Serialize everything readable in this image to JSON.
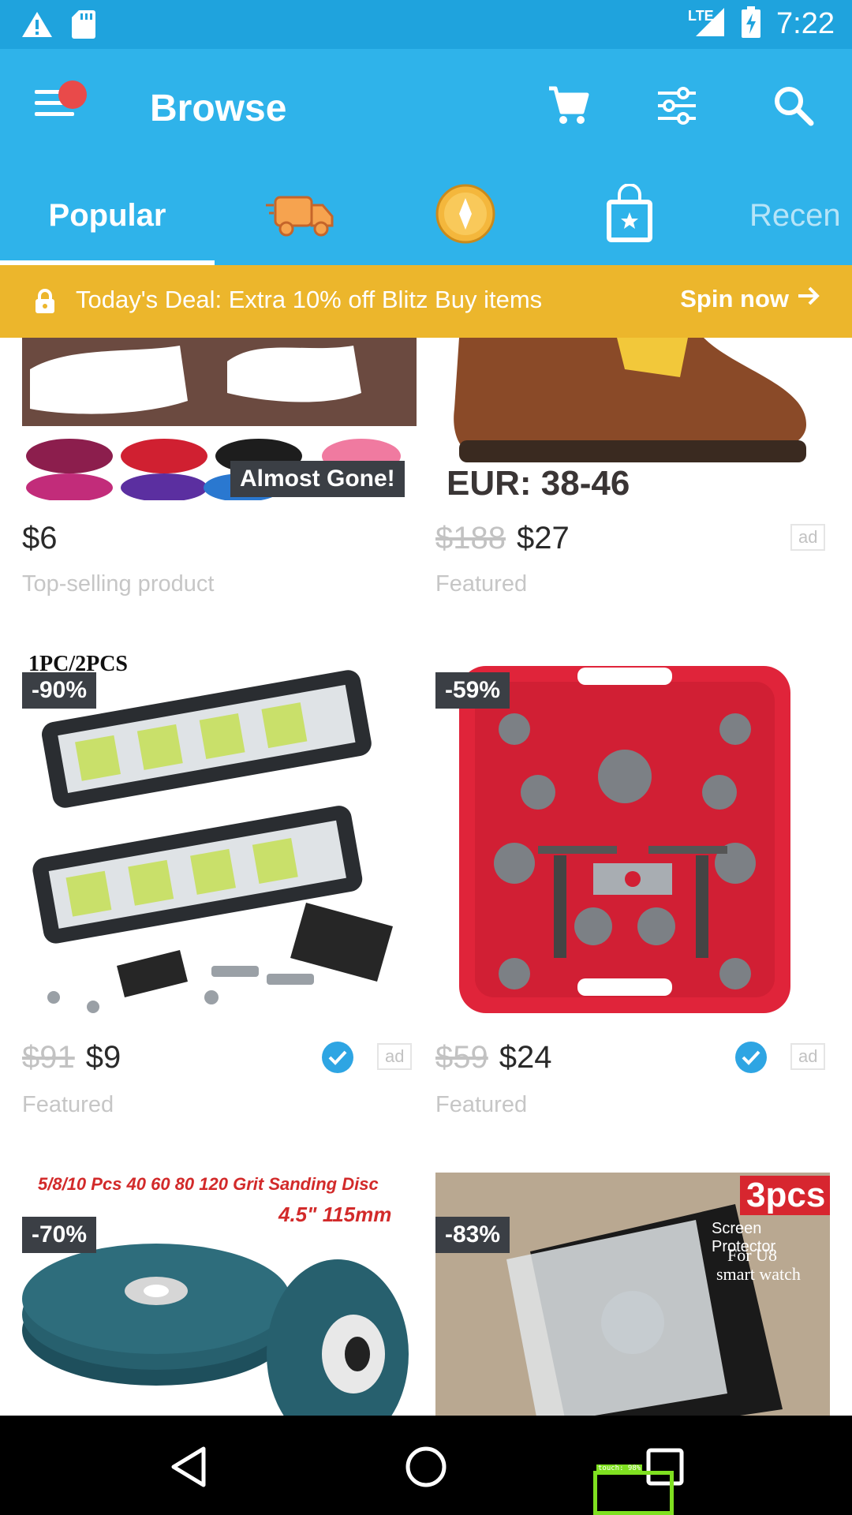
{
  "status_bar": {
    "time": "7:22",
    "network": "LTE",
    "icons": [
      "warning-icon",
      "sd-card-icon",
      "signal-icon",
      "battery-charging-icon"
    ]
  },
  "app_bar": {
    "title": "Browse",
    "notification_dot_color": "#e94a4a",
    "actions": [
      "cart-icon",
      "filter-icon",
      "search-icon"
    ]
  },
  "tabs": {
    "active": "Popular",
    "items": [
      {
        "label": "Popular",
        "icon": ""
      },
      {
        "label": "",
        "icon": "fast-shipping-truck-icon"
      },
      {
        "label": "",
        "icon": "coin-icon"
      },
      {
        "label": "",
        "icon": "shopping-bag-star-icon"
      },
      {
        "label": "Recen",
        "icon": ""
      }
    ]
  },
  "deal_banner": {
    "text": "Today's Deal: Extra 10% off Blitz Buy items",
    "cta": "Spin now"
  },
  "products": [
    {
      "badge": "Almost Gone!",
      "image_text": "",
      "old_price": "",
      "price": "$6",
      "subtitle": "Top-selling product",
      "verified": false,
      "ad": false
    },
    {
      "badge": "",
      "image_text": "EUR: 38-46",
      "old_price": "$188",
      "price": "$27",
      "subtitle": "Featured",
      "verified": false,
      "ad": true
    },
    {
      "badge": "-90%",
      "image_text": "1PC/2PCS",
      "old_price": "$91",
      "price": "$9",
      "subtitle": "Featured",
      "verified": true,
      "ad": true
    },
    {
      "badge": "-59%",
      "image_text": "",
      "old_price": "$59",
      "price": "$24",
      "subtitle": "Featured",
      "verified": true,
      "ad": true
    },
    {
      "badge": "-70%",
      "image_text": "5/8/10 Pcs 40 60 80 120 Grit Sanding Disc",
      "image_text_2": "4.5\" 115mm"
    },
    {
      "badge": "-83%",
      "image_text": "3pcs",
      "image_text_2": "Screen Protector",
      "image_text_3": "For U8",
      "image_text_4": "smart watch"
    }
  ],
  "ad_label": "ad",
  "nav_bar": {
    "buttons": [
      "back-icon",
      "home-icon",
      "recents-icon"
    ],
    "touch_overlay": "touch: 98%"
  },
  "colors": {
    "status_bar": "#1fa3dd",
    "app_bar": "#2fb3ea",
    "deal_banner": "#ecb62c",
    "badge": "#3b3f45",
    "verified": "#2ea5e3"
  }
}
